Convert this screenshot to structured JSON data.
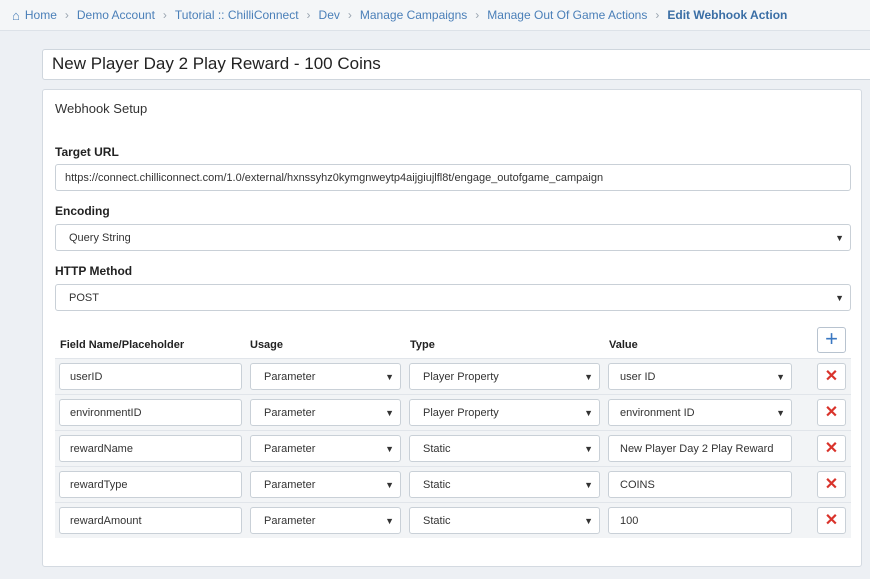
{
  "breadcrumb": {
    "items": [
      "Home",
      "Demo Account",
      "Tutorial :: ChilliConnect",
      "Dev",
      "Manage Campaigns",
      "Manage Out Of Game Actions"
    ],
    "current": "Edit Webhook Action"
  },
  "action_title": "New Player Day 2 Play Reward - 100 Coins",
  "panel": {
    "header": "Webhook Setup",
    "target_url_label": "Target URL",
    "target_url": "https://connect.chilliconnect.com/1.0/external/hxnssyhz0kymgnweytp4aijgiujlfl8t/engage_outofgame_campaign",
    "encoding_label": "Encoding",
    "encoding": "Query String",
    "http_method_label": "HTTP Method",
    "http_method": "POST"
  },
  "table": {
    "headers": {
      "name": "Field Name/Placeholder",
      "usage": "Usage",
      "type": "Type",
      "value": "Value"
    },
    "rows": [
      {
        "name": "userID",
        "usage": "Parameter",
        "type": "Player Property",
        "value": "user ID",
        "value_is_select": true
      },
      {
        "name": "environmentID",
        "usage": "Parameter",
        "type": "Player Property",
        "value": "environment ID",
        "value_is_select": true
      },
      {
        "name": "rewardName",
        "usage": "Parameter",
        "type": "Static",
        "value": "New Player Day 2 Play Reward",
        "value_is_select": false
      },
      {
        "name": "rewardType",
        "usage": "Parameter",
        "type": "Static",
        "value": "COINS",
        "value_is_select": false
      },
      {
        "name": "rewardAmount",
        "usage": "Parameter",
        "type": "Static",
        "value": "100",
        "value_is_select": false
      }
    ]
  },
  "icons": {
    "home": "home-icon",
    "add": "plus-icon",
    "delete": "close-icon",
    "caret": "caret-down-icon"
  },
  "colors": {
    "link": "#4a7fb8",
    "delete": "#d9332b",
    "add": "#3a78c2"
  }
}
